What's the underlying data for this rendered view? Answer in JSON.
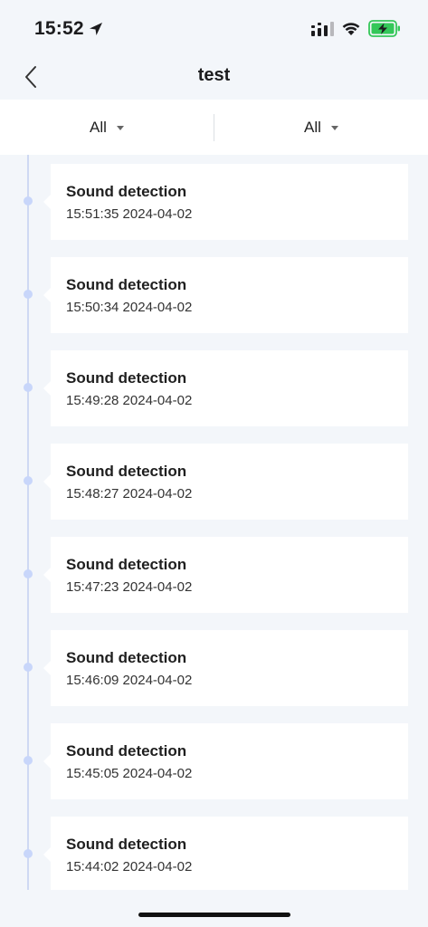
{
  "status_bar": {
    "time": "15:52",
    "icons": [
      "location-arrow-icon",
      "cellular-signal-icon",
      "wifi-icon",
      "battery-charging-icon"
    ]
  },
  "nav": {
    "title": "test",
    "back_icon": "chevron-left-icon"
  },
  "filters": [
    {
      "label": "All"
    },
    {
      "label": "All"
    }
  ],
  "events": [
    {
      "title": "Sound detection",
      "time": "15:51:35 2024-04-02"
    },
    {
      "title": "Sound detection",
      "time": "15:50:34 2024-04-02"
    },
    {
      "title": "Sound detection",
      "time": "15:49:28 2024-04-02"
    },
    {
      "title": "Sound detection",
      "time": "15:48:27 2024-04-02"
    },
    {
      "title": "Sound detection",
      "time": "15:47:23 2024-04-02"
    },
    {
      "title": "Sound detection",
      "time": "15:46:09 2024-04-02"
    },
    {
      "title": "Sound detection",
      "time": "15:45:05 2024-04-02"
    },
    {
      "title": "Sound detection",
      "time": "15:44:02 2024-04-02"
    }
  ],
  "colors": {
    "background": "#f3f6fa",
    "card": "#ffffff",
    "timeline_dot": "#c8d6fa",
    "battery_green": "#34c759"
  }
}
